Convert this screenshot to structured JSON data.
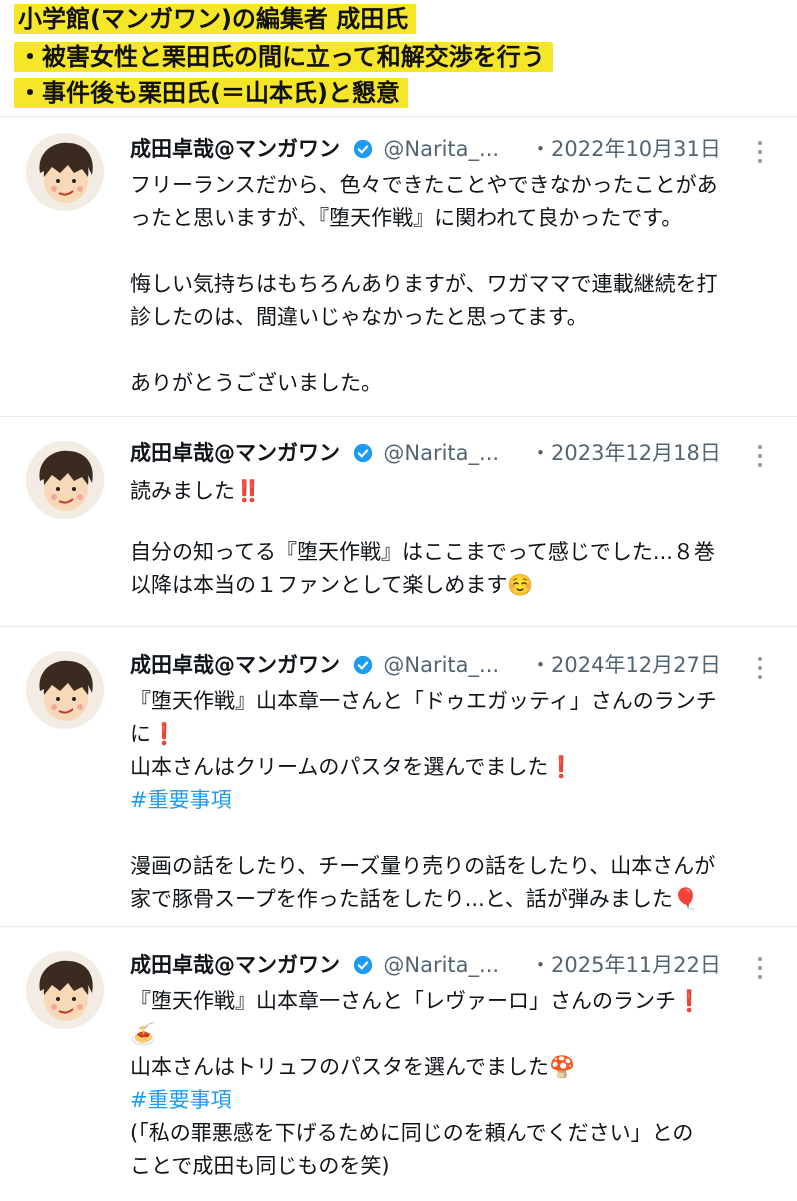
{
  "banner": {
    "line1": "小学館(マンガワン)の編集者 成田氏",
    "line2": "・被害女性と栗田氏の間に立って和解交渉を行う",
    "line3": "・事件後も栗田氏(＝山本氏)と懇意"
  },
  "tweets": [
    {
      "name": "成田卓哉@マンガワン",
      "handle": "@Narita_...",
      "date": "・2022年10月31日",
      "lines": [
        "フリーランスだから、色々できたことやできなかったことがあ",
        "ったと思いますが、『堕天作戦』に関われて良かったです。",
        "",
        "悔しい気持ちはもちろんありますが、ワガママで連載継続を打",
        "診したのは、間違いじゃなかったと思ってます。",
        "",
        "ありがとうございました。"
      ]
    },
    {
      "name": "成田卓哉@マンガワン",
      "handle": "@Narita_...",
      "date": "・2023年12月18日",
      "lines": [
        "読みました‼️",
        "",
        "自分の知ってる『堕天作戦』はここまでって感じでした...８巻",
        "以降は本当の１ファンとして楽しめます☺️"
      ]
    },
    {
      "name": "成田卓哉@マンガワン",
      "handle": "@Narita_...",
      "date": "・2024年12月27日",
      "lines": [
        "『堕天作戦』山本章一さんと「ドゥエガッティ」さんのランチ",
        "に❗",
        "山本さんはクリームのパスタを選んでました❗",
        "#重要事項",
        "",
        "漫画の話をしたり、チーズ量り売りの話をしたり、山本さんが",
        "家で豚骨スープを作った話をしたり...と、話が弾みました🎈"
      ]
    },
    {
      "name": "成田卓哉@マンガワン",
      "handle": "@Narita_...",
      "date": "・2025年11月22日",
      "lines": [
        "『堕天作戦』山本章一さんと「レヴァーロ」さんのランチ❗",
        "🍝",
        "山本さんはトリュフのパスタを選んでました🍄",
        "#重要事項",
        "(「私の罪悪感を下げるために同じのを頼んでください」との",
        "ことで成田も同じものを笑)"
      ]
    }
  ],
  "colors": {
    "banner_highlight": "#f5e62a",
    "hashtag": "#1d9bf0",
    "verified": "#1d9bf0",
    "secondary_text": "#536471"
  },
  "icons": [
    "verified-badge-icon",
    "more-options-icon",
    "avatar-illustration"
  ]
}
